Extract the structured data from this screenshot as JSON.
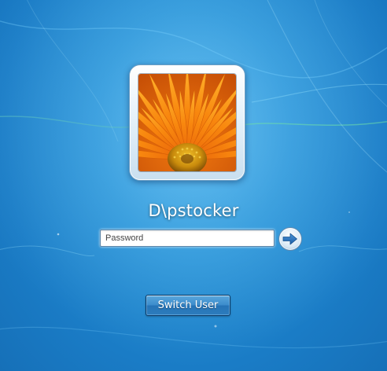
{
  "user": {
    "display_name": "D\\pstocker",
    "avatar_icon": "orange-gerbera-flower-avatar"
  },
  "login": {
    "password_placeholder": "Password",
    "password_value": "",
    "submit_icon": "arrow-right-icon"
  },
  "actions": {
    "switch_user_label": "Switch User"
  },
  "colors": {
    "background": "#2b95d8",
    "button_blue": "#3c8ccc",
    "arrow_blue": "#2a6fb5",
    "flower_orange": "#f47a08",
    "flower_center": "#d49a10"
  }
}
